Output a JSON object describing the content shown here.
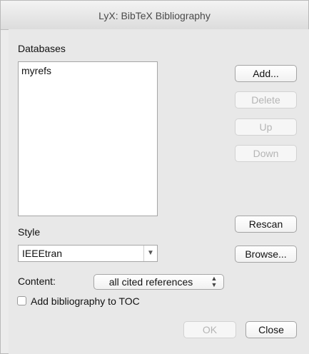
{
  "window": {
    "title": "LyX: BibTeX Bibliography"
  },
  "databases": {
    "label": "Databases",
    "items": [
      "myrefs"
    ],
    "add_label": "Add...",
    "delete_label": "Delete",
    "up_label": "Up",
    "down_label": "Down"
  },
  "style": {
    "label": "Style",
    "value": "IEEEtran",
    "rescan_label": "Rescan",
    "browse_label": "Browse..."
  },
  "content": {
    "label": "Content:",
    "selected": "all cited references"
  },
  "toc": {
    "checkbox_label": "Add bibliography to TOC",
    "checked": false
  },
  "footer": {
    "ok_label": "OK",
    "close_label": "Close"
  },
  "icons": {
    "combo_arrow": "chevron-down-icon",
    "select_arrows": "up-down-arrows-icon"
  },
  "colors": {
    "window_bg": "#ececec",
    "disabled_text": "#b5b5b5"
  }
}
